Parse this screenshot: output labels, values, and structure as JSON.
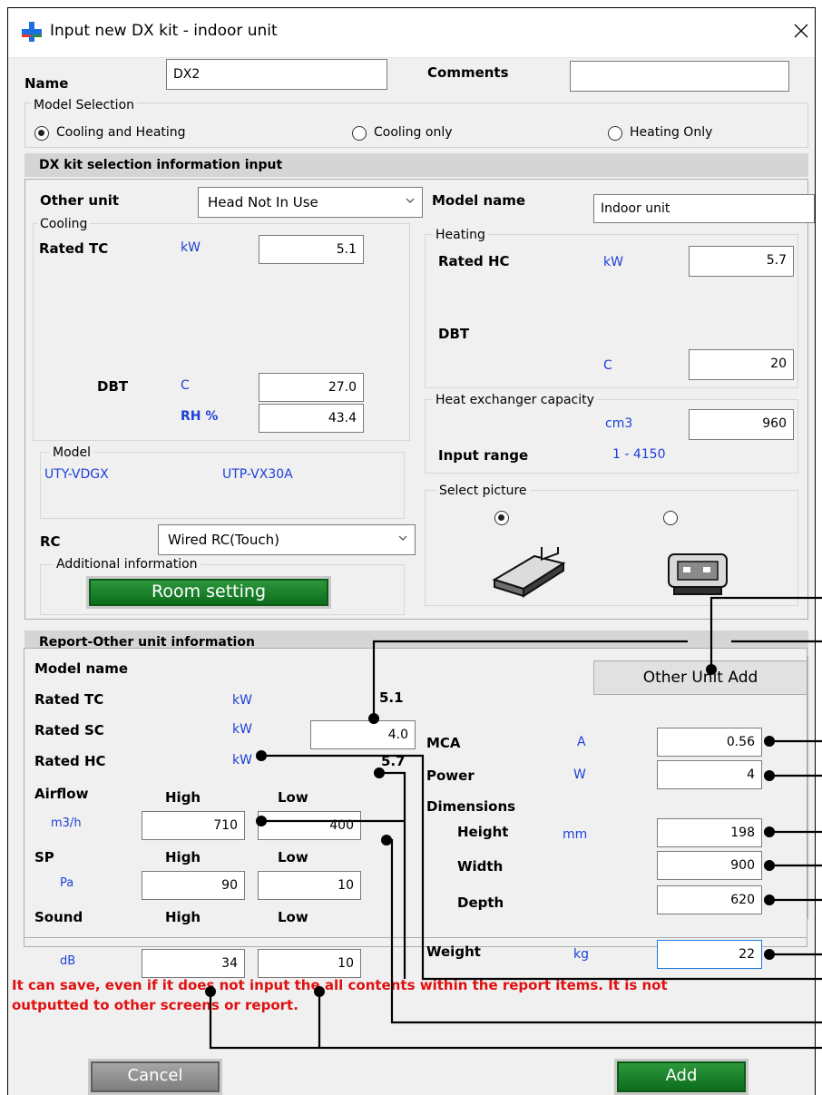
{
  "window": {
    "title": "Input new DX kit - indoor  unit"
  },
  "top": {
    "name_label": "Name",
    "name_value": "DX2",
    "comments_label": "Comments",
    "comments_value": ""
  },
  "model_selection": {
    "legend": "Model Selection",
    "options": [
      "Cooling and Heating",
      "Cooling only",
      "Heating Only"
    ],
    "selected": "Cooling and Heating"
  },
  "dx_section": {
    "title": "DX kit selection information input",
    "other_unit_label": "Other unit",
    "other_unit_value": "Head Not In Use",
    "cooling_legend": "Cooling",
    "rated_tc_label": "Rated TC",
    "rated_tc_unit": "kW",
    "rated_tc_value": "5.1",
    "dbt_label": "DBT",
    "dbt_unit": "C",
    "dbt_value": "27.0",
    "rh_unit": "RH %",
    "rh_value": "43.4",
    "model_legend": "Model",
    "model_indoor": "UTY-VDGX",
    "model_outdoor": "UTP-VX30A",
    "rc_label": "RC",
    "rc_value": "Wired RC(Touch)",
    "additional_legend": "Additional information",
    "room_setting_button": "Room setting",
    "model_name_label": "Model name",
    "model_name_value": "Indoor unit",
    "heating_legend": "Heating",
    "rated_hc_label": "Rated HC",
    "rated_hc_unit": "kW",
    "rated_hc_value": "5.7",
    "h_dbt_label": "DBT",
    "h_dbt_unit": "C",
    "h_dbt_value": "20",
    "hex_legend": "Heat exchanger capacity",
    "hex_unit": "cm3",
    "hex_value": "960",
    "input_range_label": "Input range",
    "input_range_value": "1 - 4150",
    "picture_legend": "Select picture",
    "picture_selected": 0
  },
  "report": {
    "title": "Report-Other unit information",
    "model_name_label": "Model name",
    "other_unit_add_button": "Other Unit Add",
    "rated_tc_label": "Rated TC",
    "rated_tc_unit": "kW",
    "rated_tc_value": "5.1",
    "rated_sc_label": "Rated SC",
    "rated_sc_unit": "kW",
    "rated_sc_value": "4.0",
    "rated_hc_label": "Rated HC",
    "rated_hc_unit": "kW",
    "rated_hc_value": "5.7",
    "airflow_label": "Airflow",
    "airflow_unit": "m3/h",
    "high_label": "High",
    "low_label": "Low",
    "airflow_high": "710",
    "airflow_low": "400",
    "sp_label": "SP",
    "sp_unit": "Pa",
    "sp_high": "90",
    "sp_low": "10",
    "sound_label": "Sound",
    "sound_unit": "dB",
    "sound_high": "34",
    "sound_low": "10",
    "mca_label": "MCA",
    "mca_unit": "A",
    "mca_value": "0.56",
    "power_label": "Power",
    "power_unit": "W",
    "power_value": "4",
    "dimensions_label": "Dimensions",
    "height_label": "Height",
    "height_unit": "mm",
    "height_value": "198",
    "width_label": "Width",
    "width_value": "900",
    "depth_label": "Depth",
    "depth_value": "620",
    "weight_label": "Weight",
    "weight_unit": "kg",
    "weight_value": "22"
  },
  "note": {
    "line1": "It can save, even if it does not input the all contents within the report items. It is not",
    "line2": "outputted to other screens or report."
  },
  "buttons": {
    "cancel": "Cancel",
    "add": "Add"
  },
  "colors": {
    "accent_blue": "#1e3fd8",
    "warning_red": "#e01010",
    "green_button": "#1c7d2a"
  }
}
